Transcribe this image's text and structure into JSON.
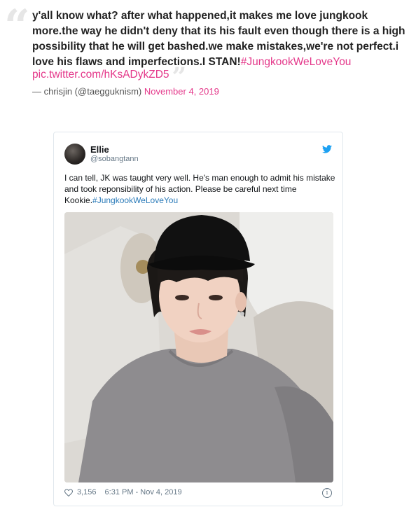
{
  "quote": {
    "open_mark": "“",
    "close_mark": "”",
    "text": "y'all know what? after what happened,it makes me love jungkook more.the way he didn't deny that its his fault even though there is a high possibility that he will get bashed.we make mistakes,we're not perfect.i love his flaws and imperfections.I STAN!",
    "hashtag": "#JungkookWeLoveYou",
    "pic_link": "pic.twitter.com/hKsADykZD5",
    "attribution": "— chrisjin (@taegguknism)",
    "date": "November 4, 2019"
  },
  "tweet": {
    "name": "Ellie",
    "handle": "@sobangtann",
    "text": "I can tell, JK was taught very well. He's man enough to admit his mistake and took reponsibility of his action. Please be careful next time Kookie.",
    "hashtag": "#JungkookWeLoveYou",
    "like_count": "3,156",
    "timestamp": "6:31 PM - Nov 4, 2019",
    "twitter_icon": "twitter-bird-icon",
    "like_icon": "heart-icon",
    "info_icon": "info-icon",
    "accent": "#1da1f2"
  },
  "colors": {
    "link_pink": "#e4388a",
    "hashtag_blue": "#2b7bb9"
  }
}
